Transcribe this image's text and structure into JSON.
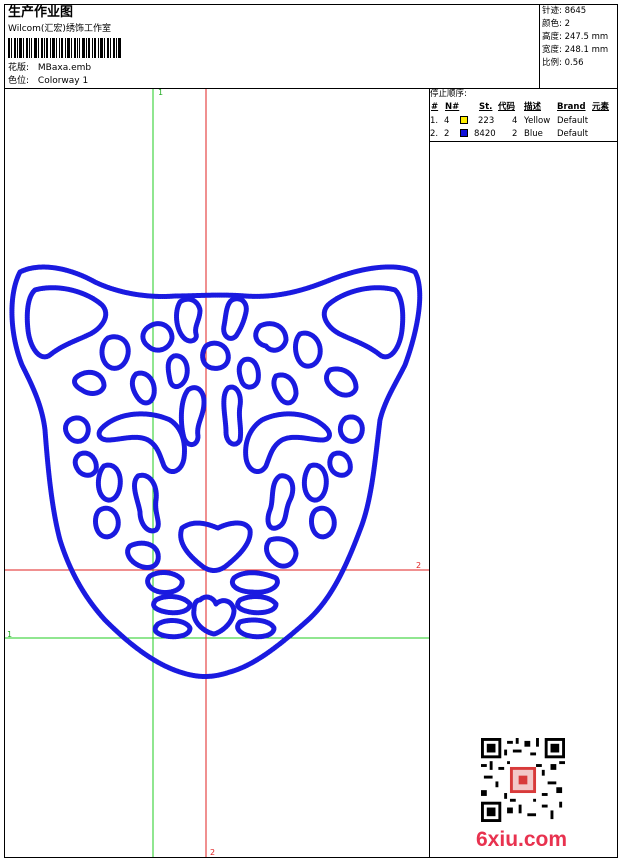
{
  "header": {
    "title": "生产作业图",
    "subtitle": "Wilcom(汇宏)绣饰工作室",
    "pattern_label": "花版:",
    "pattern_value": "MBaxa.emb",
    "colorway_label": "色位:",
    "colorway_value": "Colorway 1"
  },
  "stats": [
    {
      "label": "针迹:",
      "value": "8645"
    },
    {
      "label": "颜色:",
      "value": "2"
    },
    {
      "label": "高度:",
      "value": "247.5 mm"
    },
    {
      "label": "宽度:",
      "value": "248.1 mm"
    },
    {
      "label": "比例:",
      "value": "0.56"
    }
  ],
  "stop_sequence": {
    "title": "停止顺序:",
    "columns": [
      "#",
      "N#",
      "St.",
      "代码",
      "描述",
      "Brand",
      "元素"
    ],
    "rows": [
      {
        "num": "1.",
        "n": "4",
        "swatch": "#ffee00",
        "st": "223",
        "code": "4",
        "desc": "Yellow",
        "brand": "Default"
      },
      {
        "num": "2.",
        "n": "2",
        "swatch": "#1010d8",
        "st": "8420",
        "code": "2",
        "desc": "Blue",
        "brand": "Default"
      }
    ]
  },
  "guides": {
    "green_v": "1",
    "green_h": "1",
    "red_v": "2",
    "red_h": "2"
  },
  "colors": {
    "stitch": "#1a1ae0",
    "green_guide": "#22cc22",
    "red_guide": "#e02020"
  },
  "watermark": {
    "text": "6xiu.com"
  }
}
